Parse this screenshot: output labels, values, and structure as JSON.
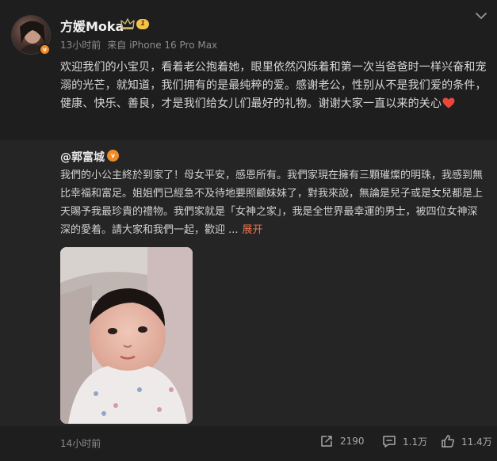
{
  "author": {
    "name": "方媛Moka",
    "level": "1",
    "verified_mark": "v"
  },
  "meta": {
    "time": "13小时前",
    "source": "来自 iPhone 16 Pro Max"
  },
  "post": {
    "text": "欢迎我们的小宝贝，看着老公抱着她，眼里依然闪烁着和第一次当爸爸时一样兴奋和宠溺的光芒，就知道，我们拥有的是最纯粹的爱。感谢老公，性别从不是我们爱的条件，健康、快乐、善良，才是我们给女儿们最好的礼物。谢谢大家一直以来的关心"
  },
  "repost": {
    "author": "@郭富城",
    "verified_mark": "v",
    "text": "我們的小公主終於到家了！母女平安，感恩所有。我們家現在擁有三顆璀燦的明珠，我感到無比幸福和富足。姐姐們已經急不及待地要照顧妹妹了，對我來說，無論是兒子或是女兒都是上天賜予我最珍貴的禮物。我們家就是「女神之家」，我是全世界最幸運的男士，被四位女神深深的愛着。請大家和我們一起，歡迎 ...",
    "expand_label": "展开",
    "time": "14小时前"
  },
  "actions": {
    "share_count": "2190",
    "comment_count": "1.1万",
    "like_count": "11.4万"
  },
  "colors": {
    "background": "#1e1e1e",
    "repost_background": "#252525",
    "link": "#eb7350",
    "verified": "#f08a24",
    "heart": "#e8473a"
  },
  "icons": [
    "crown-icon",
    "heart-icon",
    "chevron-down-icon",
    "share-icon",
    "comment-icon",
    "like-icon",
    "verified-icon"
  ]
}
